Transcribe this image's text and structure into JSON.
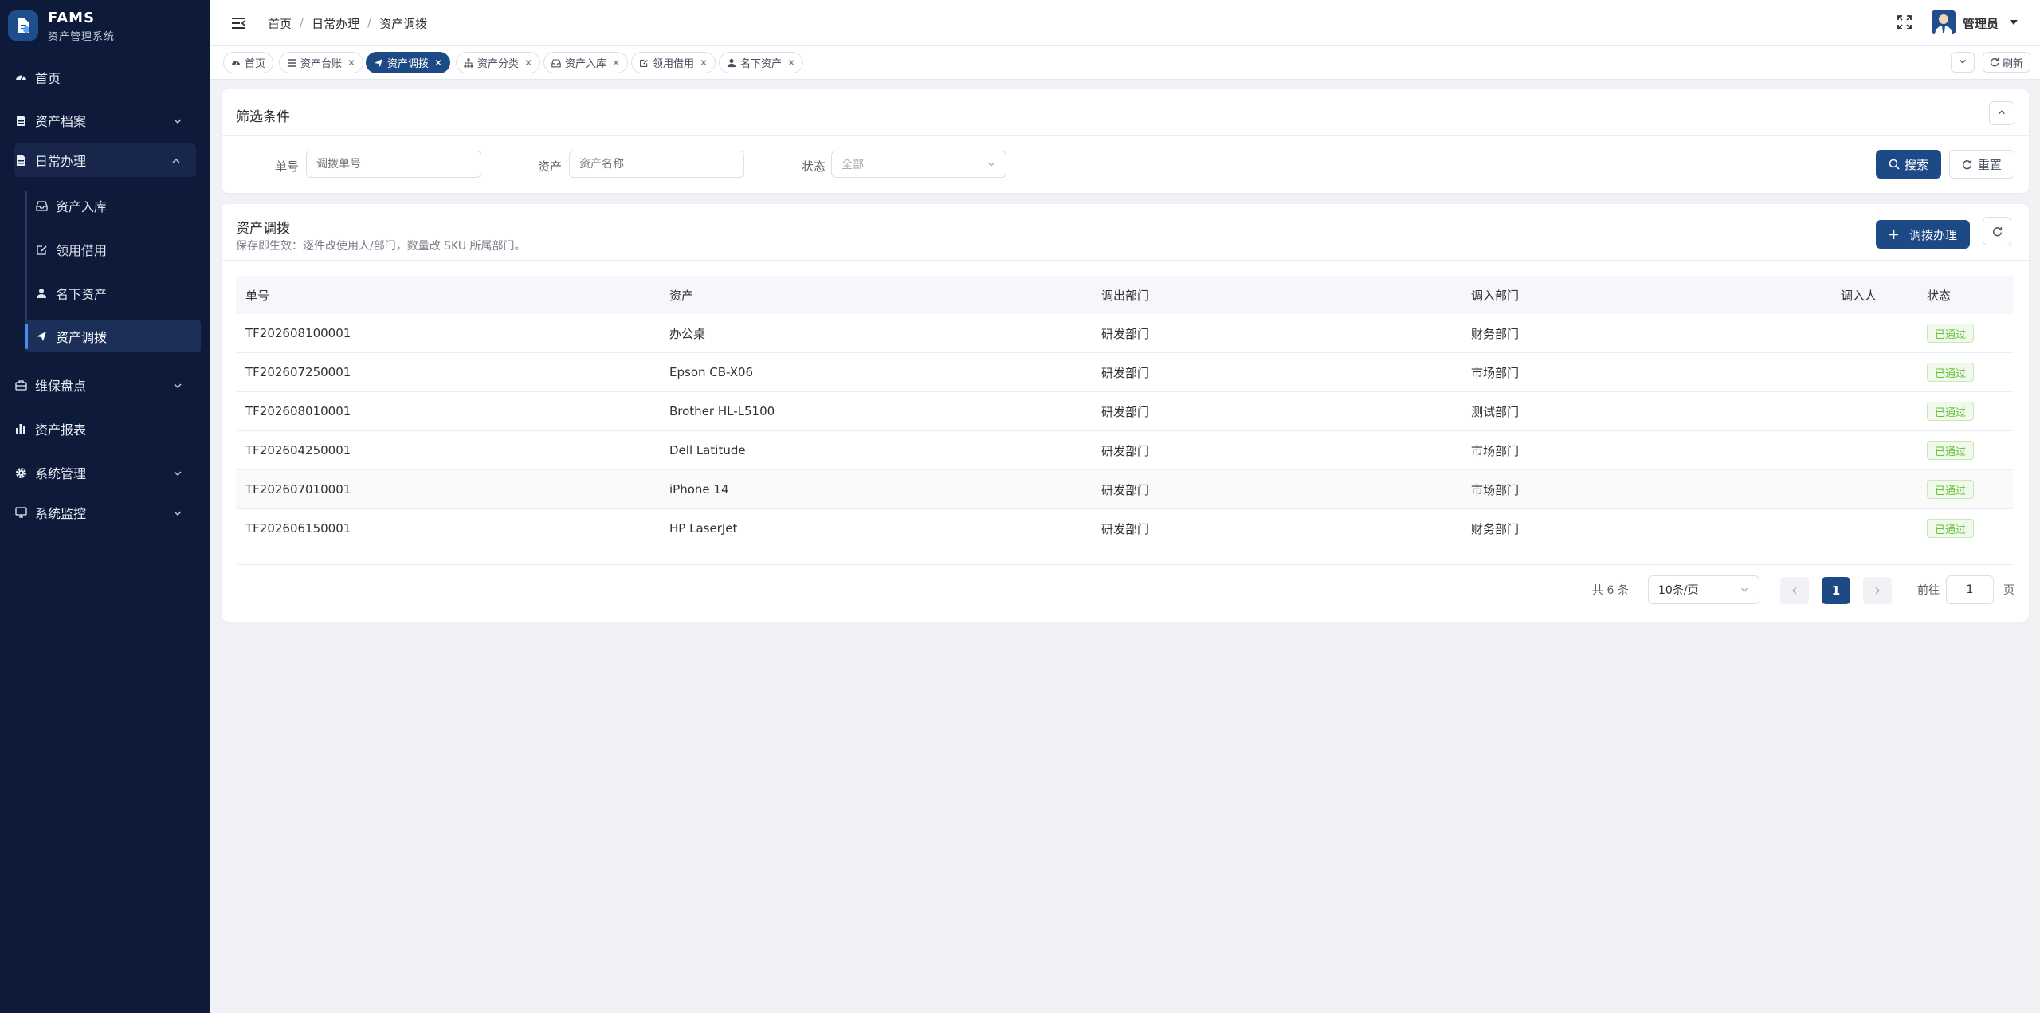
{
  "brand": {
    "title": "FAMS",
    "subtitle": "资产管理系统"
  },
  "sidebar": {
    "items": [
      {
        "label": "首页",
        "icon": "dashboard-icon"
      },
      {
        "label": "资产档案",
        "icon": "file-icon"
      },
      {
        "label": "日常办理",
        "icon": "file-icon"
      },
      {
        "label": "维保盘点",
        "icon": "briefcase-icon"
      },
      {
        "label": "资产报表",
        "icon": "bar-chart-icon"
      },
      {
        "label": "系统管理",
        "icon": "gear-icon"
      },
      {
        "label": "系统监控",
        "icon": "monitor-icon"
      }
    ],
    "subitems": [
      {
        "label": "资产入库",
        "icon": "inbox-icon"
      },
      {
        "label": "领用借用",
        "icon": "edit-icon"
      },
      {
        "label": "名下资产",
        "icon": "user-icon"
      },
      {
        "label": "资产调拨",
        "icon": "send-icon"
      }
    ]
  },
  "header": {
    "breadcrumb": [
      "首页",
      "日常办理",
      "资产调拨"
    ],
    "username": "管理员"
  },
  "tags": [
    {
      "label": "首页",
      "icon": "dashboard-icon",
      "closable": false
    },
    {
      "label": "资产台账",
      "icon": "list-icon",
      "closable": true
    },
    {
      "label": "资产调拨",
      "icon": "send-icon",
      "closable": true,
      "active": true
    },
    {
      "label": "资产分类",
      "icon": "sitemap-icon",
      "closable": true
    },
    {
      "label": "资产入库",
      "icon": "inbox-icon",
      "closable": true
    },
    {
      "label": "领用借用",
      "icon": "edit-icon",
      "closable": true
    },
    {
      "label": "名下资产",
      "icon": "user-icon",
      "closable": true
    }
  ],
  "tags_refresh": "刷新",
  "filter": {
    "title": "筛选条件",
    "fields": [
      {
        "label": "单号",
        "placeholder": "调拨单号"
      },
      {
        "label": "资产",
        "placeholder": "资产名称"
      },
      {
        "label": "状态",
        "value": "全部"
      }
    ],
    "search_label": "搜索",
    "reset_label": "重置"
  },
  "table": {
    "title": "资产调拨",
    "subtitle": "保存即生效：逐件改使用人/部门，数量改 SKU 所属部门。",
    "add_label": "调拨办理",
    "columns": [
      "单号",
      "资产",
      "调出部门",
      "调入部门",
      "调入人",
      "状态"
    ],
    "rows": [
      [
        "TF202608100001",
        "办公桌",
        "研发部门",
        "财务部门",
        "",
        "已通过"
      ],
      [
        "TF202607250001",
        "Epson CB-X06",
        "研发部门",
        "市场部门",
        "",
        "已通过"
      ],
      [
        "TF202608010001",
        "Brother HL-L5100",
        "研发部门",
        "测试部门",
        "",
        "已通过"
      ],
      [
        "TF202604250001",
        "Dell Latitude",
        "研发部门",
        "市场部门",
        "",
        "已通过"
      ],
      [
        "TF202607010001",
        "iPhone 14",
        "研发部门",
        "市场部门",
        "",
        "已通过"
      ],
      [
        "TF202606150001",
        "HP LaserJet",
        "研发部门",
        "财务部门",
        "",
        "已通过"
      ]
    ]
  },
  "pagination": {
    "total": "共 6 条",
    "page_size": "10条/页",
    "current": "1",
    "jump_prefix": "前往",
    "jump_value": "1",
    "jump_suffix": "页"
  },
  "colors": {
    "sidebar_bg": "#0e1a3a",
    "primary": "#1d4a87",
    "success": "#67c23a"
  }
}
